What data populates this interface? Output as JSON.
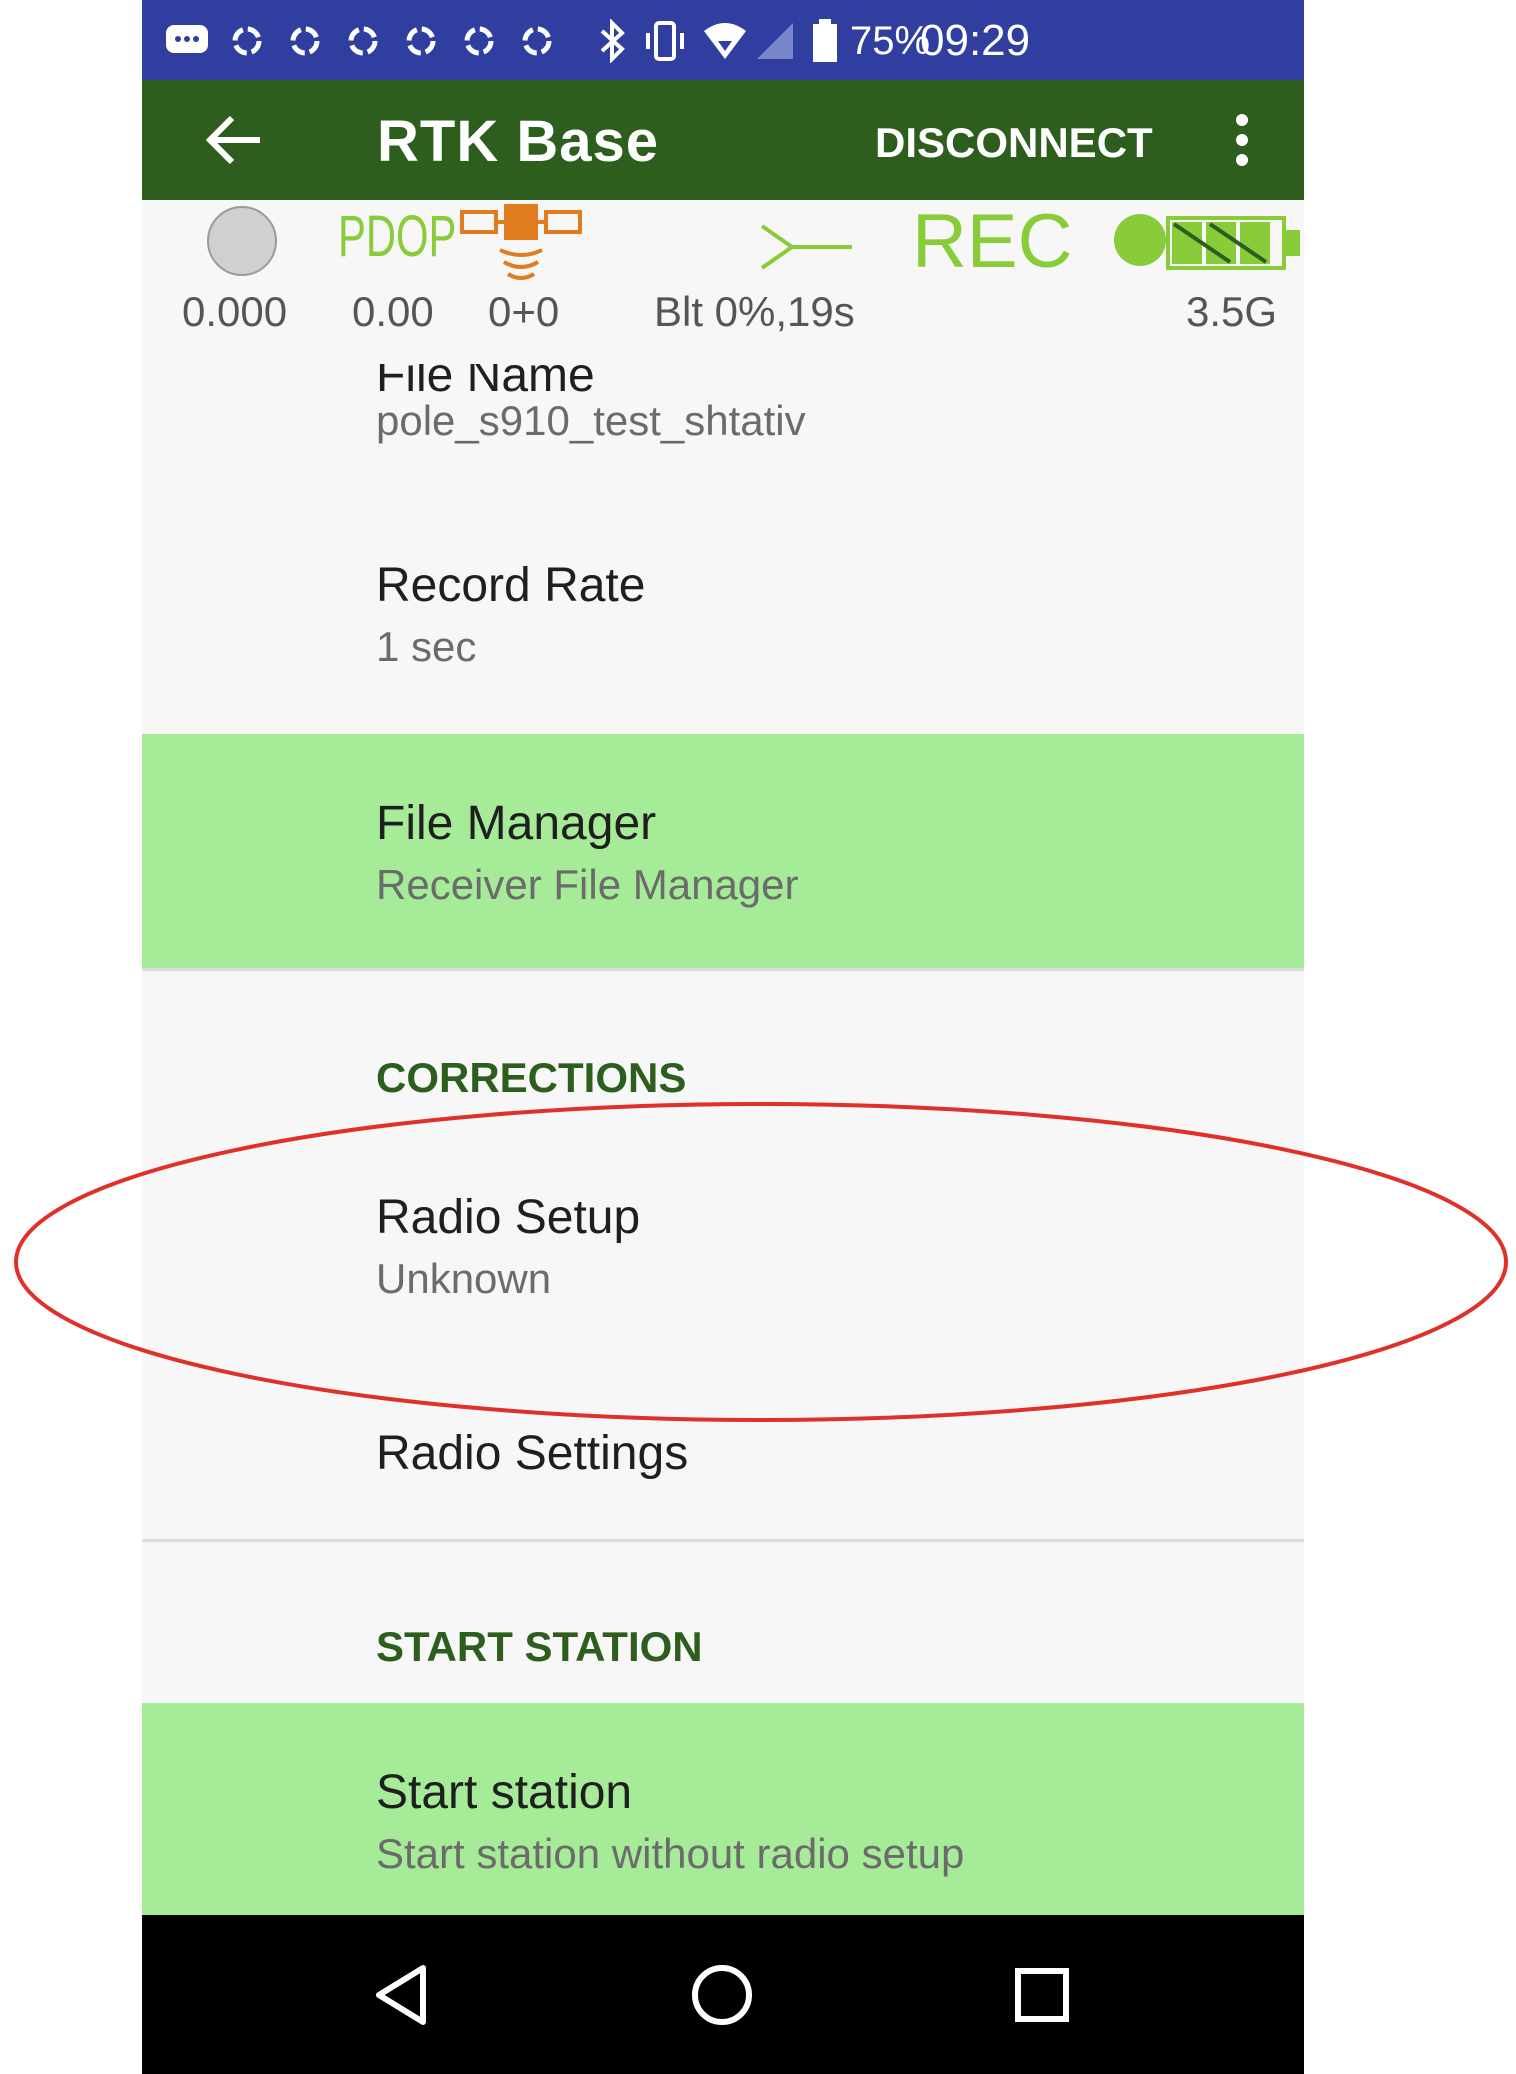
{
  "status_bar": {
    "battery": "75%",
    "time": "09:29",
    "icons": [
      "message-icon",
      "sync-icon",
      "sync-icon",
      "sync-icon",
      "sync-icon",
      "sync-icon",
      "sync-icon",
      "bluetooth-icon",
      "vibrate-icon",
      "wifi-icon",
      "signal-icon",
      "battery-icon"
    ]
  },
  "toolbar": {
    "title": "RTK Base",
    "action_label": "DISCONNECT",
    "back_icon": "arrow-left-icon",
    "more_icon": "more-vert-icon"
  },
  "indicators": {
    "pdop_label": "PDOP",
    "rec_label": "REC",
    "values": {
      "accuracy": "0.000",
      "pdop": "0.00",
      "satellites": "0+0",
      "bluetooth": "Blt 0%,19s",
      "network": "3.5G"
    },
    "colors": {
      "accent_green": "#88cc3a",
      "status_gray": "#d0d0d0"
    }
  },
  "list": {
    "file_name": {
      "title": "File Name",
      "value": "pole_s910_test_shtativ"
    },
    "record_rate": {
      "title": "Record Rate",
      "value": "1 sec"
    },
    "file_manager": {
      "title": "File Manager",
      "value": "Receiver File Manager"
    },
    "corrections_header": "CORRECTIONS",
    "radio_setup": {
      "title": "Radio Setup",
      "value": "Unknown"
    },
    "radio_settings": {
      "title": "Radio Settings"
    },
    "start_header": "START STATION",
    "start_station": {
      "title": "Start station",
      "value": "Start station without radio setup"
    }
  },
  "colors": {
    "status_bar": "#303f9f",
    "toolbar": "#2e5e1e",
    "highlight": "#a5eb98",
    "section_header": "#2e5e1e",
    "annotation": "#e0302a"
  }
}
